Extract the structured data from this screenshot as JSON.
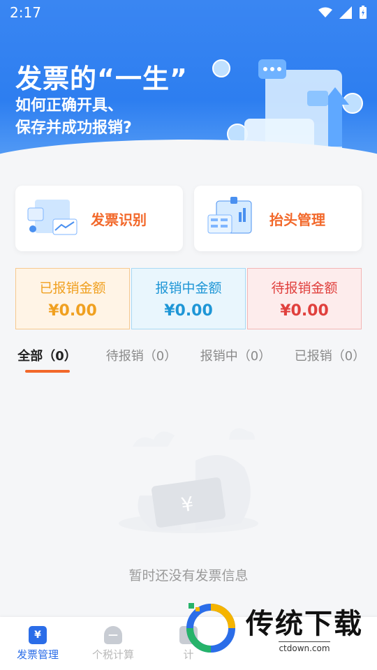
{
  "status": {
    "time": "2:17"
  },
  "banner": {
    "title": "发票的“一生”",
    "subtitle_line1": "如何正确开具、",
    "subtitle_line2": "保存并成功报销?"
  },
  "cards": [
    {
      "label": "发票识别",
      "icon": "invoice-scan-icon"
    },
    {
      "label": "抬头管理",
      "icon": "title-manage-icon"
    }
  ],
  "stats": [
    {
      "label": "已报销金额",
      "value": "¥0.00",
      "color": "#f0a020"
    },
    {
      "label": "报销中金额",
      "value": "¥0.00",
      "color": "#1e96d6"
    },
    {
      "label": "待报销金额",
      "value": "¥0.00",
      "color": "#e0403d"
    }
  ],
  "tabs": [
    {
      "label": "全部（0）"
    },
    {
      "label": "待报销（0）"
    },
    {
      "label": "报销中（0）"
    },
    {
      "label": "已报销（0）"
    }
  ],
  "empty": {
    "text": "暂时还没有发票信息",
    "icon": "empty-ticket-icon"
  },
  "nav": [
    {
      "label": "发票管理",
      "icon_text": "¥",
      "icon": "invoice-manage-icon"
    },
    {
      "label": "个税计算",
      "icon_text": "—",
      "icon": "tax-calc-icon"
    },
    {
      "label": "计",
      "icon_text": "",
      "icon": "calculator-icon"
    }
  ],
  "watermark": {
    "main": "传统下载",
    "sub": "ctdown.com"
  },
  "colors": {
    "accent": "#f2682a",
    "primary": "#2b6de8"
  }
}
